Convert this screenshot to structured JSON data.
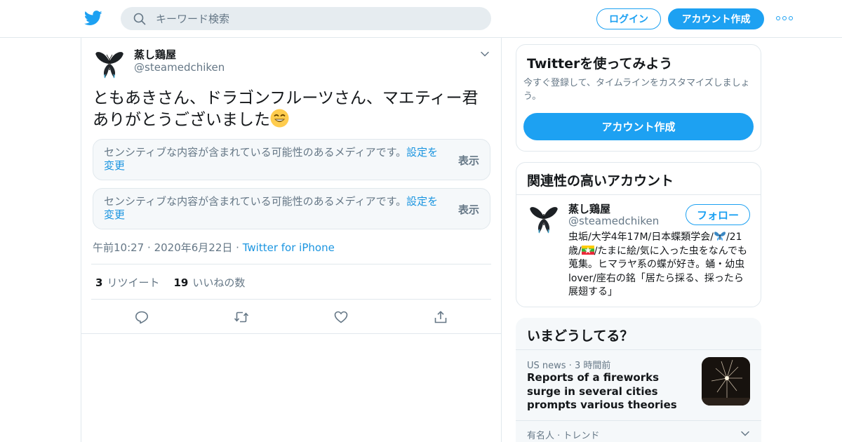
{
  "header": {
    "search_placeholder": "キーワード検索",
    "login_label": "ログイン",
    "signup_label": "アカウント作成"
  },
  "tweet": {
    "author_name": "蒸し鶏屋",
    "author_handle": "@steamedchiken",
    "text": "ともあきさん、ドラゴンフルーツさん、マエティー君ありがとうございました",
    "media_cards": [
      {
        "message": "センシティブな内容が含まれている可能性のあるメディアです。",
        "settings_link": "設定を変更",
        "show_label": "表示"
      },
      {
        "message": "センシティブな内容が含まれている可能性のあるメディアです。",
        "settings_link": "設定を変更",
        "show_label": "表示"
      }
    ],
    "time": "午前10:27",
    "date": "2020年6月22日",
    "separator": "·",
    "via": "Twitter for iPhone",
    "retweet_count": "3",
    "retweet_label": "リツイート",
    "like_count": "19",
    "like_label": "いいねの数"
  },
  "sidebar": {
    "try_card": {
      "title": "Twitterを使ってみよう",
      "description": "今すぐ登録して、タイムラインをカスタマイズしましょう。",
      "button_label": "アカウント作成"
    },
    "related": {
      "title": "関連性の高いアカウント",
      "account_name": "蒸し鶏屋",
      "account_handle": "@steamedchiken",
      "follow_label": "フォロー",
      "bio_part1": "虫垢/大学4年17M/日本蝶類学会/",
      "bio_part2": "/21歳/",
      "bio_part3": "/たまに絵/気に入った虫をなんでも蒐集。ヒマラヤ系の蝶が好き。蛹・幼虫lover/座右の銘「居たら採る、採ったら展翅する」"
    },
    "trends": {
      "title": "いまどうしてる？",
      "item1_context": "US news · 3 時間前",
      "item1_headline": "Reports of a fireworks surge in several cities prompts various theories",
      "item2_context": "有名人 · トレンド"
    }
  },
  "colors": {
    "brand": "#1da1f2",
    "link": "#1b95e0",
    "muted": "#657786",
    "border": "#e1e8ed",
    "panel": "#f5f8fa"
  }
}
